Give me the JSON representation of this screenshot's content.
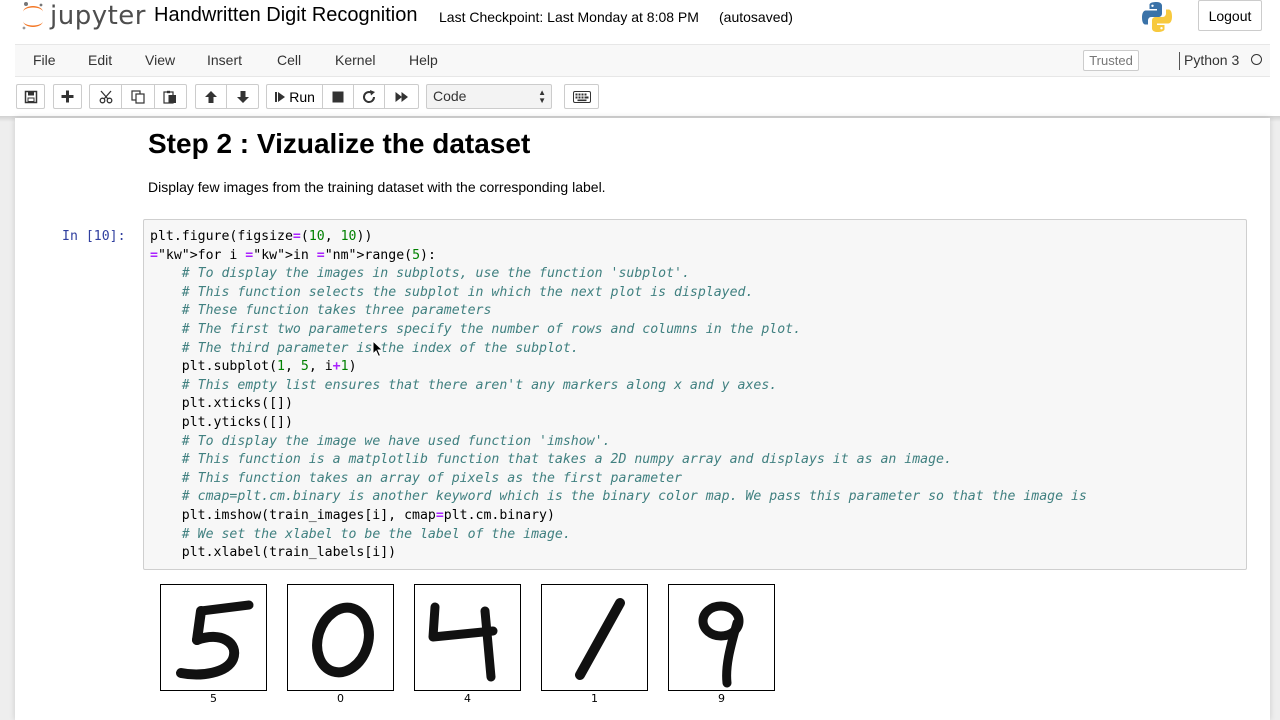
{
  "app": {
    "logo_text": "jupyter",
    "notebook_title": "Handwritten Digit Recognition",
    "checkpoint": "Last Checkpoint: Last Monday at 8:08 PM",
    "autosave": "(autosaved)",
    "logout_label": "Logout"
  },
  "menu": {
    "items": [
      "File",
      "Edit",
      "View",
      "Insert",
      "Cell",
      "Kernel",
      "Help"
    ],
    "trusted_label": "Trusted",
    "kernel_name": "Python 3"
  },
  "toolbar": {
    "run_label": "Run",
    "cell_type": "Code",
    "icons": [
      "save-icon",
      "add-cell-icon",
      "cut-icon",
      "copy-icon",
      "paste-icon",
      "move-up-icon",
      "move-down-icon",
      "run-icon",
      "stop-icon",
      "restart-icon",
      "fast-forward-icon",
      "keyboard-icon"
    ]
  },
  "markdown": {
    "heading": "Step 2 : Vizualize the dataset",
    "paragraph": "Display few images from the training dataset with the corresponding label."
  },
  "code_cell": {
    "prompt": "In [10]:",
    "lines": [
      "plt.figure(figsize=(10, 10))",
      "for i in range(5):",
      "    # To display the images in subplots, use the function 'subplot'.",
      "    # This function selects the subplot in which the next plot is displayed.",
      "    # These function takes three parameters",
      "    # The first two parameters specify the number of rows and columns in the plot.",
      "    # The third parameter is the index of the subplot.",
      "    plt.subplot(1, 5, i+1)",
      "    # This empty list ensures that there aren't any markers along x and y axes.",
      "    plt.xticks([])",
      "    plt.yticks([])",
      "    # To display the image we have used function 'imshow'.",
      "    # This function is a matplotlib function that takes a 2D numpy array and displays it as an image.",
      "    # This function takes an array of pixels as the first parameter",
      "    # cmap=plt.cm.binary is another keyword which is the binary color map. We pass this parameter so that the image is",
      "    plt.imshow(train_images[i], cmap=plt.cm.binary)",
      "    # We set the xlabel to be the label of the image.",
      "    plt.xlabel(train_labels[i])"
    ]
  },
  "output": {
    "labels": [
      "5",
      "0",
      "4",
      "1",
      "9"
    ]
  },
  "colors": {
    "prompt": "#303f9f",
    "keyword": "#008000",
    "comment": "#408080",
    "operator": "#aa22ff"
  }
}
